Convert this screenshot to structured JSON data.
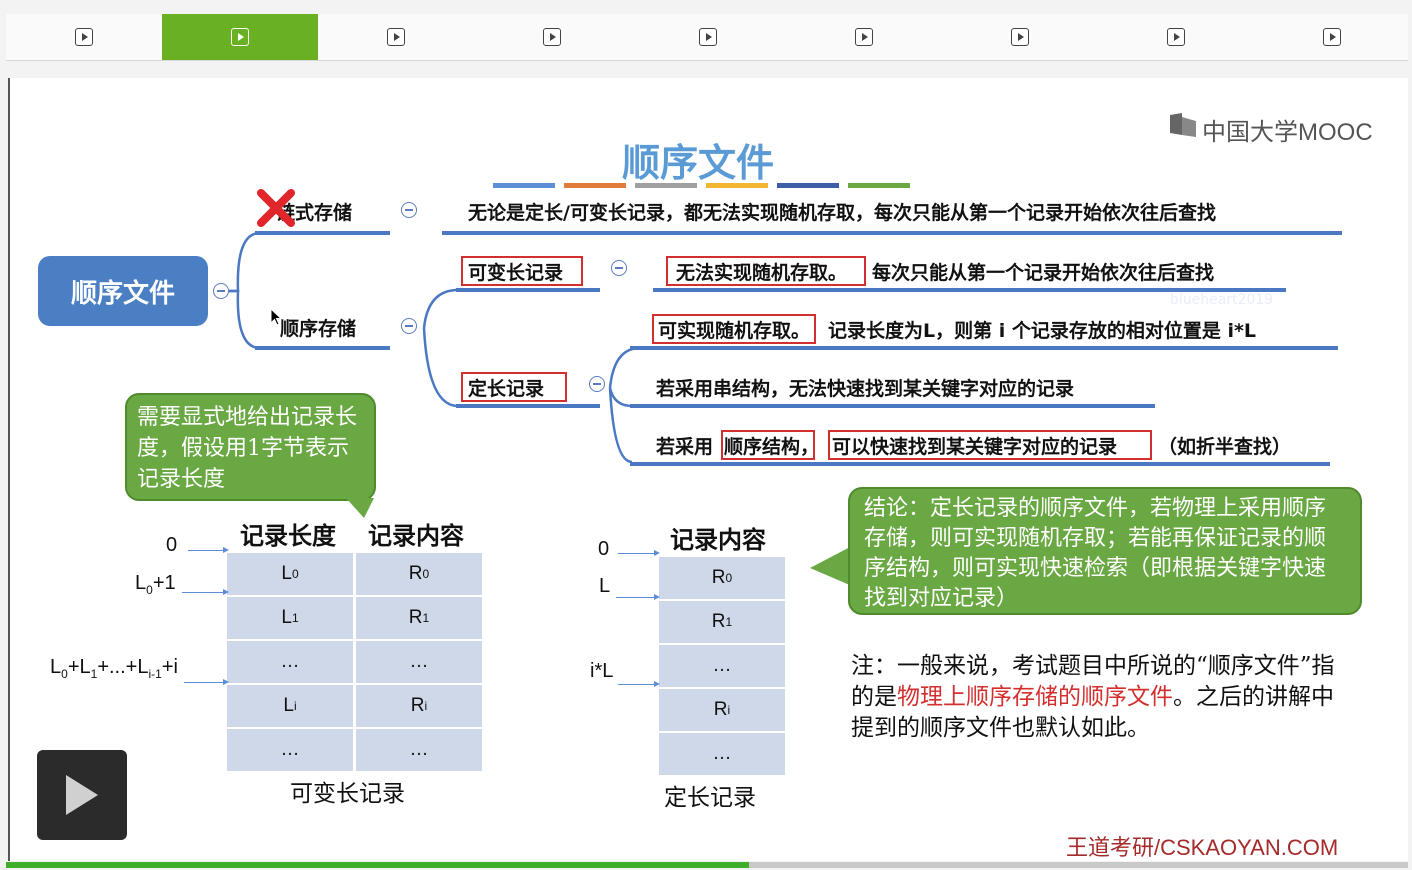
{
  "player": {
    "tabs": [
      {
        "label": "play"
      },
      {
        "label": "play"
      },
      {
        "label": "play"
      },
      {
        "label": "play"
      },
      {
        "label": "play"
      },
      {
        "label": "play"
      },
      {
        "label": "play"
      },
      {
        "label": "play"
      },
      {
        "label": "play"
      }
    ],
    "active_tab_index": 1,
    "progress_fraction": 0.53,
    "colors": {
      "accent": "#6ab023",
      "progress": "#3fae2a"
    }
  },
  "slide": {
    "logo_text": "中国大学MOOC",
    "title": "顺序文件",
    "root_label": "顺序文件",
    "branch_chain": {
      "label": "链式存储",
      "desc": "无论是定长/可变长记录，都无法实现随机存取，每次只能从第一个记录开始依次往后查找"
    },
    "branch_seq": {
      "label": "顺序存储"
    },
    "var_record": {
      "label": "可变长记录",
      "desc_boxed": "无法实现随机存取。",
      "desc_rest": "每次只能从第一个记录开始依次往后查找"
    },
    "fixed_record": {
      "label": "定长记录",
      "line1_boxed": "可实现随机存取。",
      "line1_rest": "记录长度为L，则第 i 个记录存放的相对位置是 i*L",
      "line2": "若采用串结构，无法快速找到某关键字对应的记录",
      "line3_pre": "若采用",
      "line3_box1": "顺序结构，",
      "line3_box2": "可以快速找到某关键字对应的记录",
      "line3_post": "（如折半查找）"
    },
    "watermark": "blueheart2019",
    "bubble_left": "需要显式地给出记录长度，假设用1字节表示记录长度",
    "table_var": {
      "headers": [
        "记录长度",
        "记录内容"
      ],
      "rows": [
        [
          "L0",
          "R0"
        ],
        [
          "L1",
          "R1"
        ],
        [
          "…",
          "…"
        ],
        [
          "Li",
          "Ri"
        ],
        [
          "…",
          "…"
        ]
      ],
      "offsets": [
        "0",
        "L0+1",
        "L0+L1+...+Li-1+i"
      ],
      "caption": "可变长记录"
    },
    "table_fixed": {
      "header": "记录内容",
      "rows": [
        "R0",
        "R1",
        "…",
        "Ri",
        "…"
      ],
      "offsets": [
        "0",
        "L",
        "i*L"
      ],
      "caption": "定长记录"
    },
    "bubble_right": "结论：定长记录的顺序文件，若物理上采用顺序存储，则可实现随机存取；若能再保证记录的顺序结构，则可实现快速检索（即根据关键字快速找到对应记录）",
    "note_pre": "注：一般来说，考试题目中所说的“顺序文件”指的是",
    "note_red": "物理上顺序存储的顺序文件",
    "note_post": "。之后的讲解中提到的顺序文件也默认如此。",
    "footer": "王道考研/CSKAOYAN.COM",
    "title_color_bar": [
      "#5b8ed6",
      "#e07b39",
      "#a0a0a0",
      "#f2b632",
      "#3d5fa8",
      "#6aa843"
    ]
  }
}
